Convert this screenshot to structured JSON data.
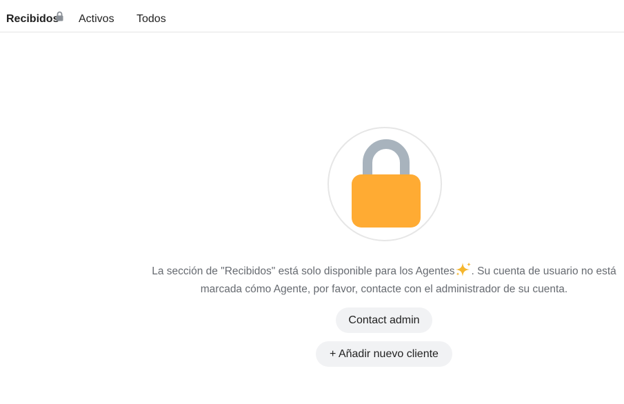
{
  "tabs": [
    {
      "label": "Recibidos",
      "active": true,
      "locked": true
    },
    {
      "label": "Activos",
      "active": false
    },
    {
      "label": "Todos",
      "active": false
    }
  ],
  "icons": {
    "tab_lock": "lock-icon",
    "main_lock": "padlock-icon",
    "sparkle": "sparkles-icon"
  },
  "colors": {
    "lock_body": "#FFAB33",
    "lock_shackle": "#A8B3BD",
    "sparkle": "#F5B62E",
    "button_bg": "#F1F2F4",
    "message_text": "#666A70"
  },
  "message": {
    "part1": "La sección de \"Recibidos\" está solo disponible para los Agentes",
    "part2": ". Su cuenta de usuario no está marcada cómo Agente, por favor, contacte con el administrador de su cuenta."
  },
  "buttons": {
    "contact_admin": "Contact admin",
    "add_client": "+ Añadir nuevo cliente"
  }
}
